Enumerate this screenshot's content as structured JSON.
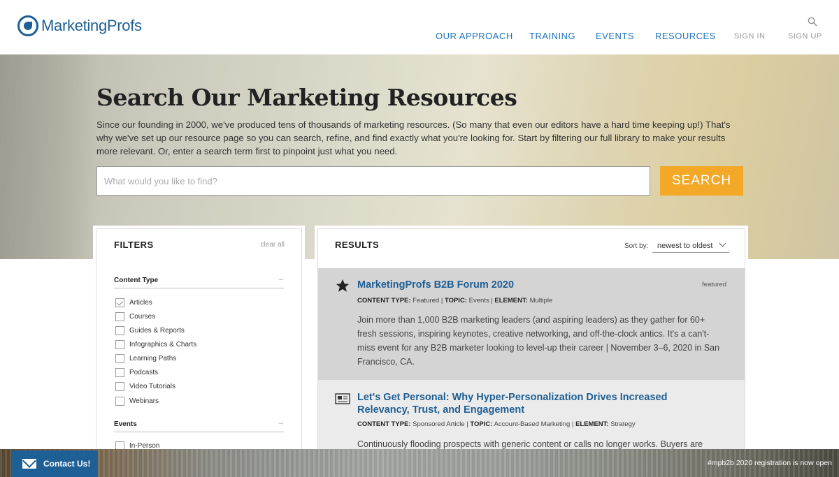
{
  "brand": {
    "logo_text": "MarketingProfs",
    "accent": "#1e5f95",
    "cta_color": "#f3a828"
  },
  "nav": {
    "primary": [
      "OUR APPROACH",
      "TRAINING",
      "EVENTS",
      "RESOURCES"
    ],
    "sign_in": "SIGN IN",
    "sign_up": "SIGN UP",
    "search_icon": "search-icon"
  },
  "hero": {
    "title": "Search Our Marketing Resources",
    "description": "Since our founding in 2000, we've produced tens of thousands of marketing resources. (So many that even our editors have a hard time keeping up!) That's why we've set up our resource page so you can search, refine, and find exactly what you're looking for. Start by filtering our full library to make your results more relevant. Or, enter a search term first to pinpoint just what you need.",
    "search_placeholder": "What would you like to find?",
    "search_button": "SEARCH"
  },
  "filters": {
    "title": "FILTERS",
    "clear_all": "clear all",
    "content_type": {
      "heading": "Content Type",
      "collapse": "–",
      "options": [
        {
          "label": "Articles",
          "checked": true
        },
        {
          "label": "Courses",
          "checked": false
        },
        {
          "label": "Guides & Reports",
          "checked": false
        },
        {
          "label": "Infographics & Charts",
          "checked": false
        },
        {
          "label": "Learning Paths",
          "checked": false
        },
        {
          "label": "Podcasts",
          "checked": false
        },
        {
          "label": "Video Tutorials",
          "checked": false
        },
        {
          "label": "Webinars",
          "checked": false
        }
      ]
    },
    "events": {
      "heading": "Events",
      "collapse": "–",
      "options": [
        {
          "label": "In-Person",
          "checked": false
        }
      ]
    }
  },
  "results": {
    "title": "RESULTS",
    "sort_label": "Sort by:",
    "sort_value": "newest to oldest",
    "items": [
      {
        "icon": "star-icon",
        "title": "MarketingProfs B2B Forum 2020",
        "badge": "featured",
        "meta_ct_label": "CONTENT TYPE:",
        "meta_ct": "Featured",
        "meta_topic_label": "TOPIC:",
        "meta_topic": "Events",
        "meta_el_label": "ELEMENT:",
        "meta_el": "Multiple",
        "desc": "Join more than 1,000 B2B marketing leaders (and aspiring leaders) as they gather for 60+ fresh sessions, inspiring keynotes, creative networking, and off-the-clock antics. It's a can't-miss event for any B2B marketer looking to level-up their career | November 3–6, 2020 in San Francisco, CA."
      },
      {
        "icon": "newspaper-icon",
        "title": "Let's Get Personal: Why Hyper-Personalization Drives Increased Relevancy, Trust, and Engagement",
        "meta_ct_label": "CONTENT TYPE:",
        "meta_ct": "Sponsored Article",
        "meta_topic_label": "TOPIC:",
        "meta_topic": "Account-Based Marketing",
        "meta_el_label": "ELEMENT:",
        "meta_el": "Strategy",
        "desc": "Continuously flooding prospects with generic content or calls no longer works. Buyers are"
      }
    ]
  },
  "footer": {
    "contact": "Contact Us!",
    "promo": "#mpb2b 2020 registration is now open"
  }
}
